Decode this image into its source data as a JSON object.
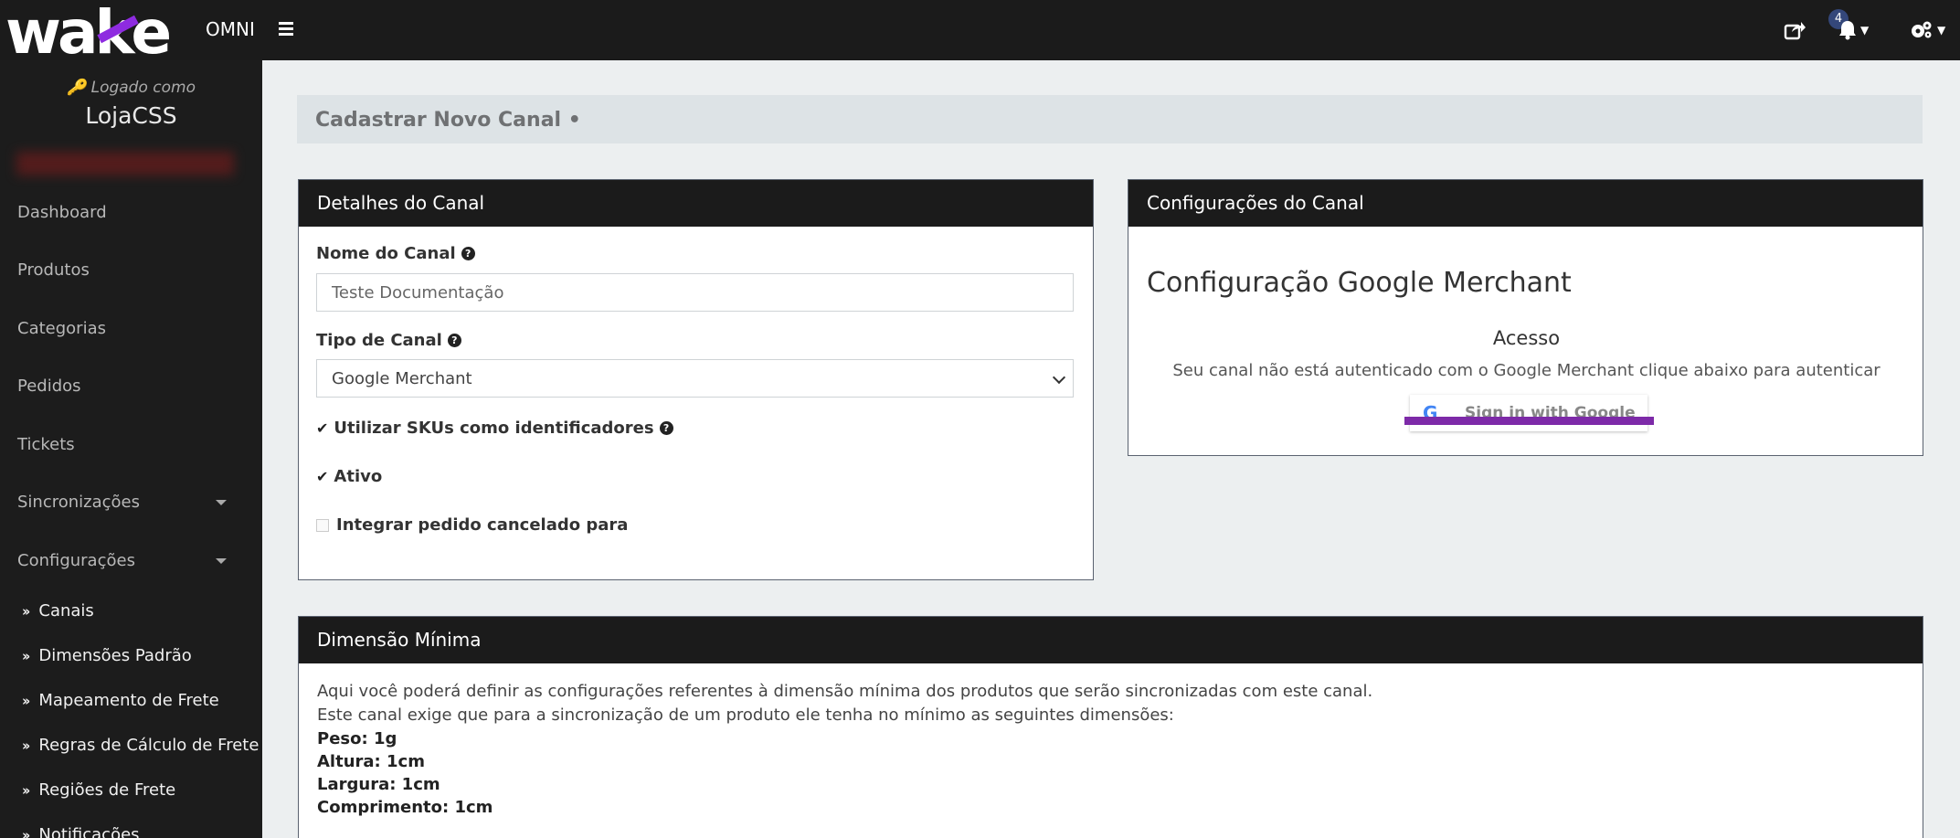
{
  "app": {
    "logo": "wake",
    "product": "OMNI"
  },
  "topbar": {
    "notifications_count": "4"
  },
  "sidebar": {
    "logged_label": "Logado como",
    "store_name": "LojaCSS",
    "items": [
      {
        "label": "Dashboard"
      },
      {
        "label": "Produtos"
      },
      {
        "label": "Categorias"
      },
      {
        "label": "Pedidos"
      },
      {
        "label": "Tickets"
      },
      {
        "label": "Sincronizações"
      },
      {
        "label": "Configurações"
      }
    ],
    "subitems": [
      {
        "label": "Canais"
      },
      {
        "label": "Dimensões Padrão"
      },
      {
        "label": "Mapeamento de Frete"
      },
      {
        "label": "Regras de Cálculo de Frete"
      },
      {
        "label": "Regiões de Frete"
      },
      {
        "label": "Notificações"
      }
    ]
  },
  "page": {
    "title": "Cadastrar Novo Canal •"
  },
  "details": {
    "heading": "Detalhes do Canal",
    "name_label": "Nome do Canal",
    "name_value": "Teste Documentação",
    "type_label": "Tipo de Canal",
    "type_value": "Google Merchant",
    "sku_label": "Utilizar SKUs como identificadores",
    "ativo_label": "Ativo",
    "cancel_label": "Integrar pedido cancelado para"
  },
  "config": {
    "heading": "Configurações do Canal",
    "title": "Configuração Google Merchant",
    "access": "Acesso",
    "auth_text": "Seu canal não está autenticado com o Google Merchant clique abaixo para autenticar",
    "signin_label": "Sign in with Google"
  },
  "dimension": {
    "heading": "Dimensão Mínima",
    "line1": "Aqui você poderá definir as configurações referentes à dimensão mínima dos produtos que serão sincronizadas com este canal.",
    "line2": "Este canal exige que para a sincronização de um produto ele tenha no mínimo as seguintes dimensões:",
    "peso": "Peso: 1g",
    "altura": "Altura: 1cm",
    "largura": "Largura: 1cm",
    "comprimento": "Comprimento: 1cm"
  }
}
